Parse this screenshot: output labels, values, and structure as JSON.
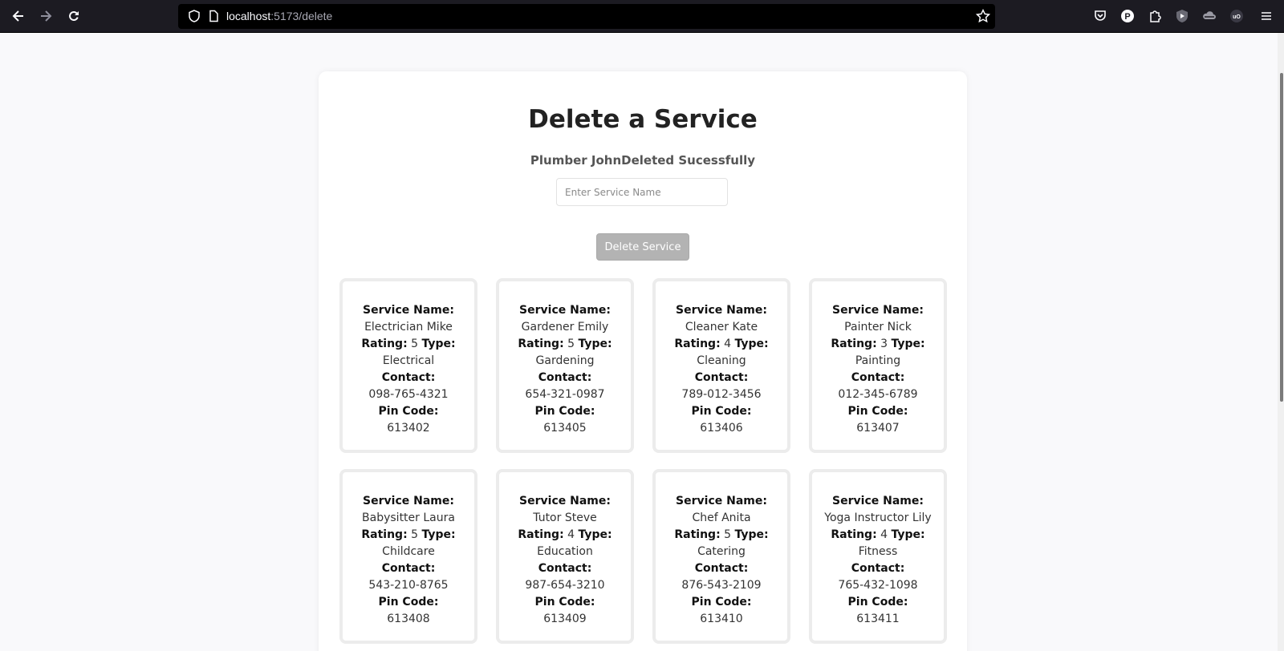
{
  "browser": {
    "url_host": "localhost",
    "url_path": ":5173/delete"
  },
  "page": {
    "title": "Delete a Service",
    "status": "Plumber JohnDeleted Sucessfully",
    "input_placeholder": "Enter Service Name",
    "input_value": "",
    "delete_button": "Delete Service"
  },
  "labels": {
    "service_name": "Service Name:",
    "rating": "Rating:",
    "type": "Type:",
    "contact": "Contact:",
    "pin_code": "Pin Code:"
  },
  "services": [
    {
      "name": "Electrician Mike",
      "rating": "5",
      "type": "Electrical",
      "contact": "098-765-4321",
      "pin": "613402"
    },
    {
      "name": "Gardener Emily",
      "rating": "5",
      "type": "Gardening",
      "contact": "654-321-0987",
      "pin": "613405"
    },
    {
      "name": "Cleaner Kate",
      "rating": "4",
      "type": "Cleaning",
      "contact": "789-012-3456",
      "pin": "613406"
    },
    {
      "name": "Painter Nick",
      "rating": "3",
      "type": "Painting",
      "contact": "012-345-6789",
      "pin": "613407"
    },
    {
      "name": "Babysitter Laura",
      "rating": "5",
      "type": "Childcare",
      "contact": "543-210-8765",
      "pin": "613408"
    },
    {
      "name": "Tutor Steve",
      "rating": "4",
      "type": "Education",
      "contact": "987-654-3210",
      "pin": "613409"
    },
    {
      "name": "Chef Anita",
      "rating": "5",
      "type": "Catering",
      "contact": "876-543-2109",
      "pin": "613410"
    },
    {
      "name": "Yoga Instructor Lily",
      "rating": "4",
      "type": "Fitness",
      "contact": "765-432-1098",
      "pin": "613411"
    }
  ]
}
